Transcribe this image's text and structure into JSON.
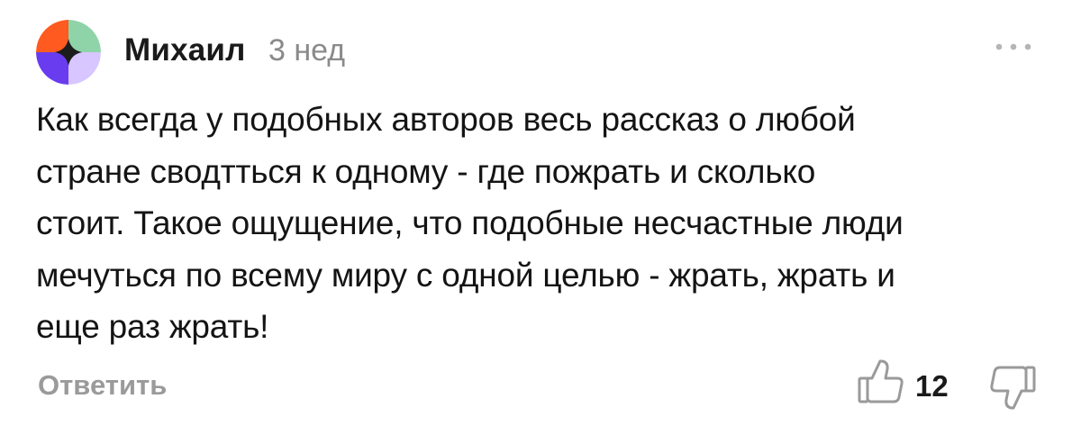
{
  "comment": {
    "author": "Михаил",
    "time": "3 нед",
    "text": "Как всегда у подобных авторов весь рассказ о любой\nстране сводтться к одному - где пожрать и сколько\nстоит. Такое ощущение, что подобные несчастные люди\nмечуться по всему миру с одной целью - жрать, жрать и\nеще раз жрать!",
    "reply_label": "Ответить",
    "likes": "12"
  },
  "icons": {
    "avatar": "avatar-quadrants",
    "more": "more-dots-icon",
    "like": "thumbs-up-icon",
    "dislike": "thumbs-down-icon"
  },
  "colors": {
    "avatar_orange": "#ff5a1f",
    "avatar_green": "#8fd3a8",
    "avatar_purple": "#6a3cf0",
    "avatar_lavender": "#d7c6ff",
    "muted_text": "#8a8a8a"
  }
}
